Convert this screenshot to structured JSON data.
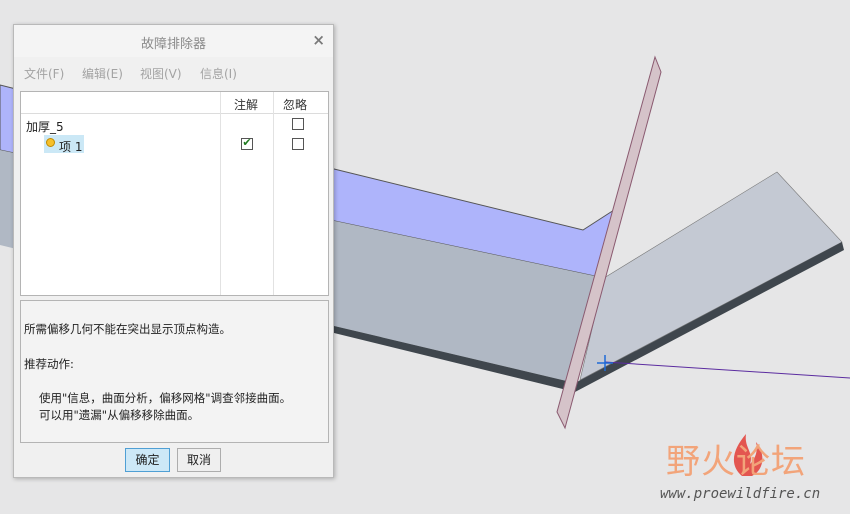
{
  "dialog": {
    "title": "故障排除器",
    "close_symbol": "×",
    "menu": [
      "文件(F)",
      "编辑(E)",
      "视图(V)",
      "信息(I)"
    ],
    "tree": {
      "columns": [
        "注解",
        "忽略"
      ],
      "feature": {
        "label": "加厚_5",
        "annotate": false,
        "ignore": false
      },
      "item": {
        "label": "项 1",
        "annotate": true,
        "ignore": false
      }
    },
    "info": {
      "message": "所需偏移几何不能在突出显示顶点构造。",
      "heading": "推荐动作:",
      "actions": [
        "使用\"信息，曲面分析，偏移网格\"调查邻接曲面。",
        "可以用\"遗漏\"从偏移移除曲面。"
      ]
    },
    "buttons": {
      "ok": "确定",
      "cancel": "取消"
    }
  },
  "watermark": {
    "title": "野火论坛",
    "url": "www.proewildfire.cn"
  },
  "colors": {
    "highlight_face": "#aeb4fb",
    "part_face": "#b0b8c4",
    "part_top": "#c4c9d3",
    "plane_edge": "#8a5a70",
    "datum_line": "#5b2ca0"
  }
}
